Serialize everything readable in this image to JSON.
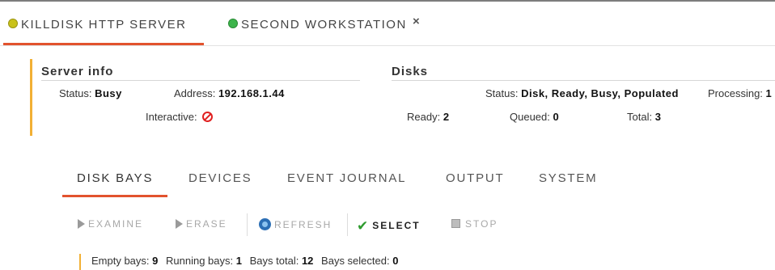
{
  "server_tabs": [
    {
      "label": "KILLDISK HTTP SERVER",
      "dot_color": "#c9c21a",
      "active": true
    },
    {
      "label": "SECOND WORKSTATION",
      "dot_color": "#3cb44b",
      "active": false,
      "close": "×"
    }
  ],
  "server_info": {
    "title": "Server info",
    "status_label": "Status:",
    "status_value": "Busy",
    "address_label": "Address:",
    "address_value": "192.168.1.44",
    "interactive_label": "Interactive:",
    "interactive_icon": "prohibited-icon"
  },
  "disks": {
    "title": "Disks",
    "status_label": "Status:",
    "status_value": "Disk, Ready, Busy, Populated",
    "processing_label": "Processing:",
    "processing_value": "1",
    "ready_label": "Ready:",
    "ready_value": "2",
    "queued_label": "Queued:",
    "queued_value": "0",
    "total_label": "Total:",
    "total_value": "3"
  },
  "subtabs": [
    "DISK BAYS",
    "DEVICES",
    "EVENT JOURNAL",
    "OUTPUT",
    "SYSTEM"
  ],
  "active_subtab": "DISK BAYS",
  "toolbar": {
    "examine": "EXAMINE",
    "erase": "ERASE",
    "refresh": "REFRESH",
    "select": "SELECT",
    "stop": "STOP"
  },
  "bay_stats": {
    "empty_label": "Empty bays:",
    "empty_value": "9",
    "running_label": "Running bays:",
    "running_value": "1",
    "total_label": "Bays total:",
    "total_value": "12",
    "selected_label": "Bays selected:",
    "selected_value": "0"
  },
  "colors": {
    "accent": "#e2532e",
    "highlight_bar": "#f2b035"
  }
}
